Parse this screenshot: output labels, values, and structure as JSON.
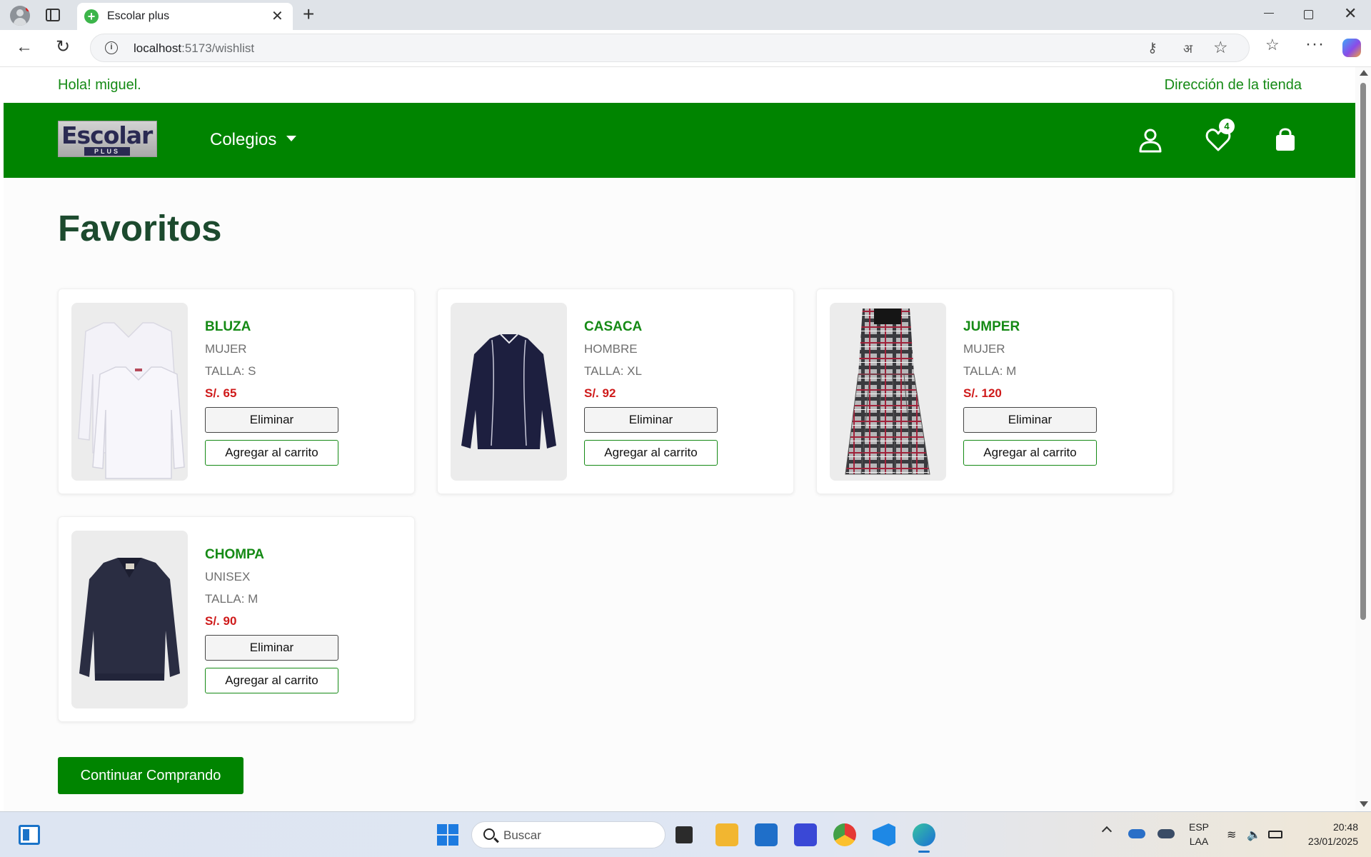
{
  "browser": {
    "tab_title": "Escolar plus",
    "url_host": "localhost",
    "url_path": ":5173/wishlist"
  },
  "topbar": {
    "greeting": "Hola! miguel.",
    "store_link": "Dirección de la tienda"
  },
  "header": {
    "logo_text": "Escolar",
    "logo_subtext": "PLUS",
    "nav_colegios": "Colegios",
    "wishlist_count": "4",
    "brand_color": "#008400"
  },
  "page": {
    "title": "Favoritos",
    "continue_label": "Continuar Comprando"
  },
  "wishlist": [
    {
      "name": "BLUZA",
      "gender": "MUJER",
      "size": "TALLA: S",
      "price": "S/. 65",
      "image_icon": "white-blouse-image",
      "delete_label": "Eliminar",
      "add_label": "Agregar al carrito"
    },
    {
      "name": "CASACA",
      "gender": "HOMBRE",
      "size": "TALLA: XL",
      "price": "S/. 92",
      "image_icon": "navy-jacket-image",
      "delete_label": "Eliminar",
      "add_label": "Agregar al carrito"
    },
    {
      "name": "JUMPER",
      "gender": "MUJER",
      "size": "TALLA: M",
      "price": "S/. 120",
      "image_icon": "plaid-jumper-image",
      "delete_label": "Eliminar",
      "add_label": "Agregar al carrito"
    },
    {
      "name": "CHOMPA",
      "gender": "UNISEX",
      "size": "TALLA: M",
      "price": "S/. 90",
      "image_icon": "navy-sweater-image",
      "delete_label": "Eliminar",
      "add_label": "Agregar al carrito"
    }
  ],
  "taskbar": {
    "search_placeholder": "Buscar",
    "lang_line1": "ESP",
    "lang_line2": "LAA",
    "time": "20:48",
    "date": "23/01/2025"
  }
}
